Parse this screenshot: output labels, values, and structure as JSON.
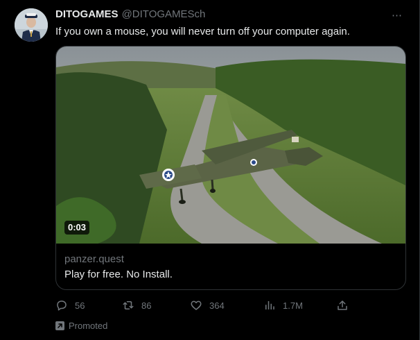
{
  "tweet": {
    "display_name": "DITOGAMES",
    "handle": "@DITOGAMESch",
    "more_icon": "⋯",
    "text": "If you own a mouse, you will never turn off your computer again."
  },
  "card": {
    "duration": "0:03",
    "domain": "panzer.quest",
    "title": "Play for free. No Install."
  },
  "actions": {
    "replies": "56",
    "retweets": "86",
    "likes": "364",
    "views": "1.7M"
  },
  "promoted": {
    "label": "Promoted"
  },
  "colors": {
    "background": "#000000",
    "text_primary": "#e7e9ea",
    "text_secondary": "#71767b",
    "border": "#2f3336"
  }
}
